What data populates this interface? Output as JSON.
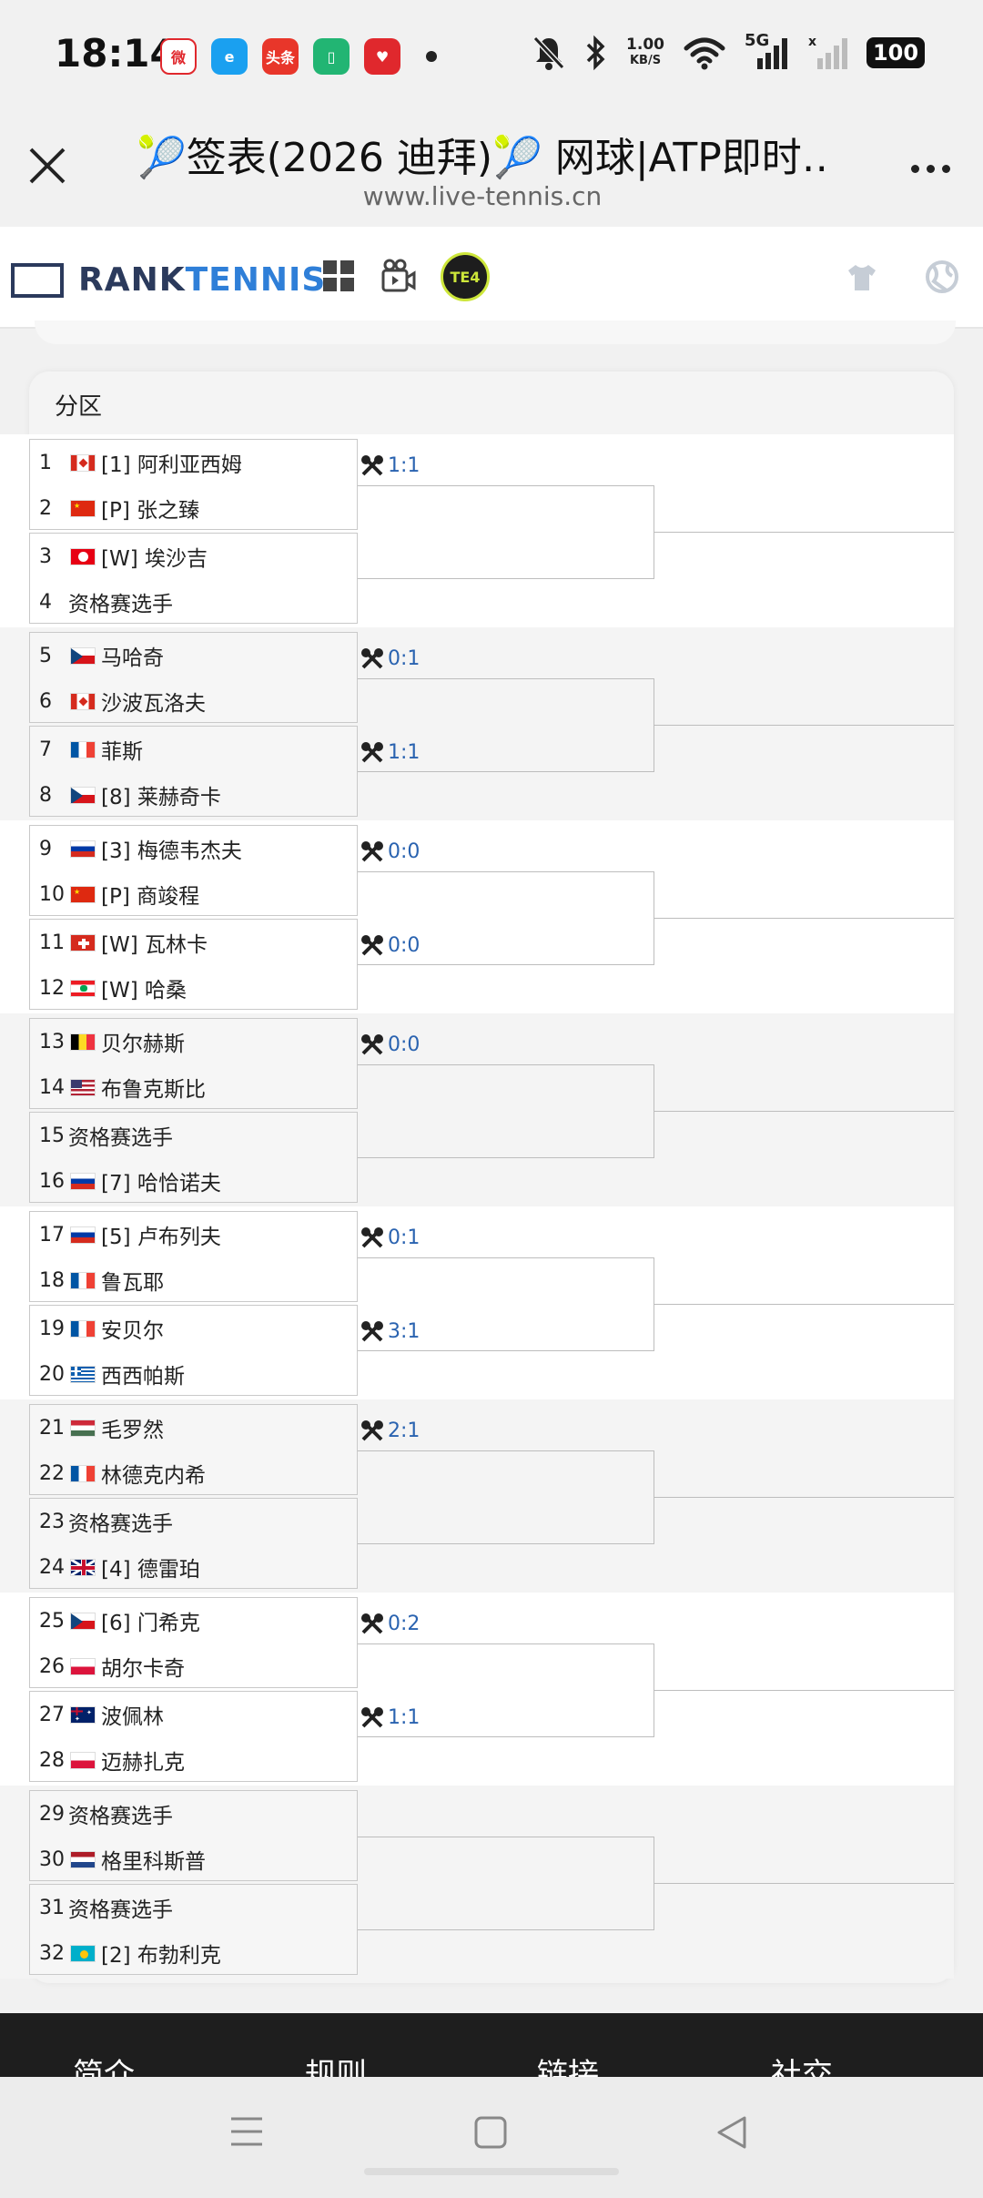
{
  "status_bar": {
    "time": "18:14",
    "speed_value": "1.00",
    "speed_unit": "KB/S",
    "network": "5G",
    "battery": "100",
    "apps": [
      {
        "name": "weibo-icon",
        "color": "#ffffff",
        "label": "微"
      },
      {
        "name": "browser-app-icon",
        "color": "#1aa0f0",
        "label": "e"
      },
      {
        "name": "toutiao-icon",
        "color": "#e8362a",
        "label": "头条"
      },
      {
        "name": "battery-app-icon",
        "color": "#22b573",
        "label": "▯"
      },
      {
        "name": "heart-app-icon",
        "color": "#e0282d",
        "label": "♥"
      }
    ]
  },
  "browser": {
    "title": "🎾签表(2026 迪拜)🎾 网球|ATP即时…",
    "url": "www.live-tennis.cn"
  },
  "site_header": {
    "logo_part1": "RANK",
    "logo_part2": "TENNIS",
    "te4_label": "TE4"
  },
  "section_label": "分区",
  "draw": [
    {
      "players": [
        {
          "num": "1",
          "flag": "ca",
          "text": "[1] 阿利亚西姆"
        },
        {
          "num": "2",
          "flag": "cn",
          "text": "[P] 张之臻"
        },
        {
          "num": "3",
          "flag": "tn",
          "text": "[W] 埃沙吉"
        },
        {
          "num": "4",
          "flag": "",
          "text": "资格赛选手"
        }
      ],
      "h2h_top": "1:1",
      "h2h_bottom": ""
    },
    {
      "players": [
        {
          "num": "5",
          "flag": "cz",
          "text": "马哈奇"
        },
        {
          "num": "6",
          "flag": "ca",
          "text": "沙波瓦洛夫"
        },
        {
          "num": "7",
          "flag": "fr",
          "text": "菲斯"
        },
        {
          "num": "8",
          "flag": "cz",
          "text": "[8] 莱赫奇卡"
        }
      ],
      "h2h_top": "0:1",
      "h2h_bottom": "1:1"
    },
    {
      "players": [
        {
          "num": "9",
          "flag": "ru",
          "text": "[3] 梅德韦杰夫"
        },
        {
          "num": "10",
          "flag": "cn",
          "text": "[P] 商竣程"
        },
        {
          "num": "11",
          "flag": "ch",
          "text": "[W] 瓦林卡"
        },
        {
          "num": "12",
          "flag": "lb",
          "text": "[W] 哈桑"
        }
      ],
      "h2h_top": "0:0",
      "h2h_bottom": "0:0"
    },
    {
      "players": [
        {
          "num": "13",
          "flag": "be",
          "text": "贝尔赫斯"
        },
        {
          "num": "14",
          "flag": "us",
          "text": "布鲁克斯比"
        },
        {
          "num": "15",
          "flag": "",
          "text": "资格赛选手"
        },
        {
          "num": "16",
          "flag": "ru",
          "text": "[7] 哈恰诺夫"
        }
      ],
      "h2h_top": "0:0",
      "h2h_bottom": ""
    },
    {
      "players": [
        {
          "num": "17",
          "flag": "ru",
          "text": "[5] 卢布列夫"
        },
        {
          "num": "18",
          "flag": "fr",
          "text": "鲁瓦耶"
        },
        {
          "num": "19",
          "flag": "fr",
          "text": "安贝尔"
        },
        {
          "num": "20",
          "flag": "gr",
          "text": "西西帕斯"
        }
      ],
      "h2h_top": "0:1",
      "h2h_bottom": "3:1"
    },
    {
      "players": [
        {
          "num": "21",
          "flag": "hu",
          "text": "毛罗然"
        },
        {
          "num": "22",
          "flag": "fr",
          "text": "林德克内希"
        },
        {
          "num": "23",
          "flag": "",
          "text": "资格赛选手"
        },
        {
          "num": "24",
          "flag": "gb",
          "text": "[4] 德雷珀"
        }
      ],
      "h2h_top": "2:1",
      "h2h_bottom": ""
    },
    {
      "players": [
        {
          "num": "25",
          "flag": "cz",
          "text": "[6] 门希克"
        },
        {
          "num": "26",
          "flag": "pl",
          "text": "胡尔卡奇"
        },
        {
          "num": "27",
          "flag": "au",
          "text": "波佩林"
        },
        {
          "num": "28",
          "flag": "pl",
          "text": "迈赫扎克"
        }
      ],
      "h2h_top": "0:2",
      "h2h_bottom": "1:1"
    },
    {
      "players": [
        {
          "num": "29",
          "flag": "",
          "text": "资格赛选手"
        },
        {
          "num": "30",
          "flag": "nl",
          "text": "格里科斯普"
        },
        {
          "num": "31",
          "flag": "",
          "text": "资格赛选手"
        },
        {
          "num": "32",
          "flag": "kz",
          "text": "[2] 布勃利克"
        }
      ],
      "h2h_top": "",
      "h2h_bottom": ""
    }
  ],
  "footer": {
    "items": [
      "简介",
      "规则",
      "链接",
      "社交"
    ]
  },
  "colors": {
    "accent": "#2a63b0",
    "logo_dark": "#2b3a5c",
    "logo_blue": "#2f7fd8"
  }
}
